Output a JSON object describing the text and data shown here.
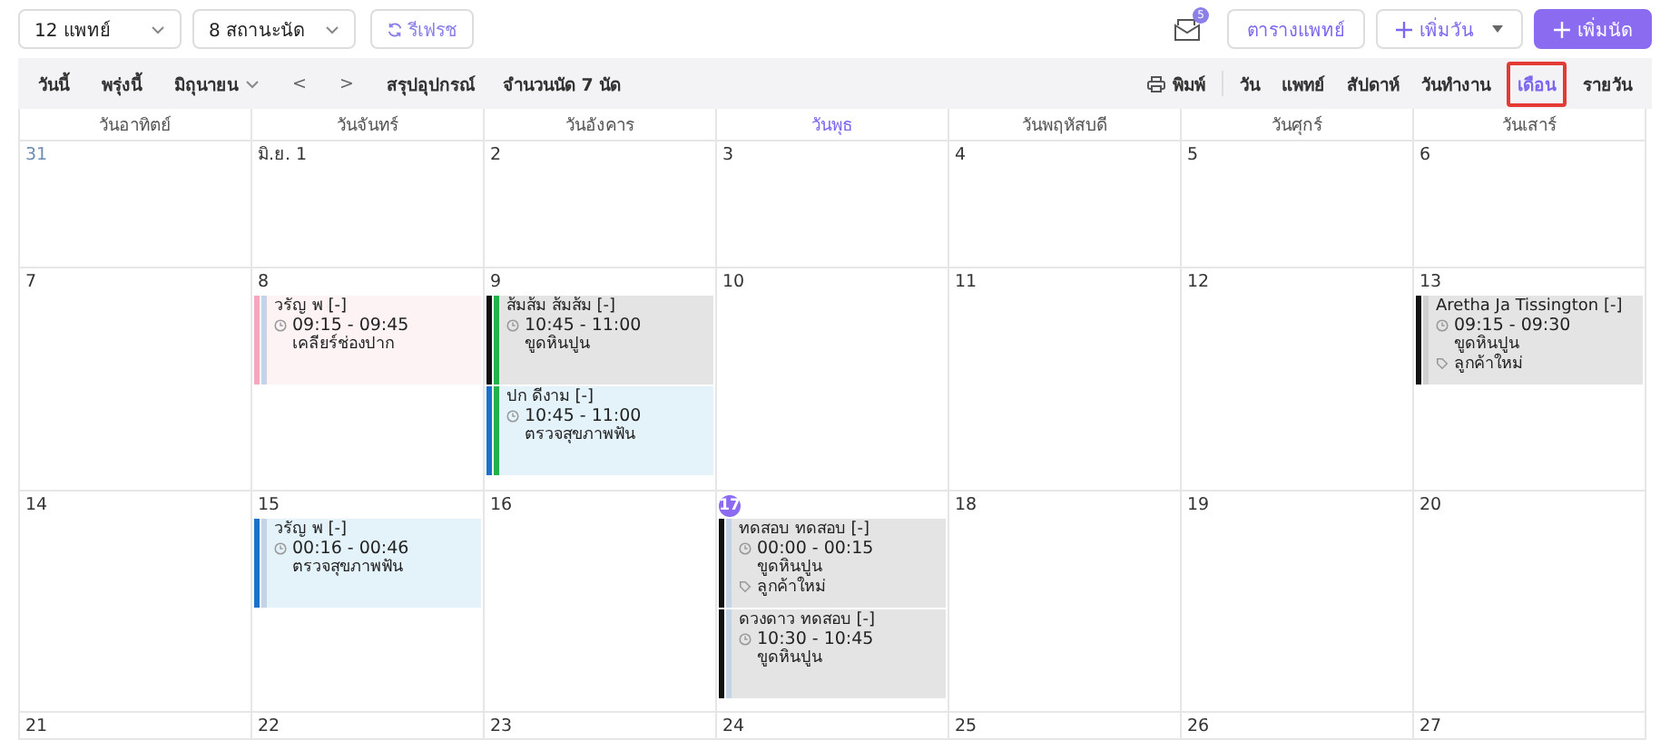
{
  "filters": [
    {
      "label": "12 แพทย์"
    },
    {
      "label": "8 สถานะนัด"
    }
  ],
  "refresh_button": "รีเฟรช",
  "inbox_badge": "5",
  "actions": [
    {
      "label": "ตารางแพทย์",
      "kind": "outline"
    },
    {
      "label": "เพิ่มวัน",
      "kind": "dropdown"
    },
    {
      "label": "เพิ่มนัด",
      "kind": "primary"
    }
  ],
  "nav": {
    "today": "วันนี้",
    "tomorrow": "พรุ่งนี้",
    "month": "มิถุนายน",
    "prev": "<",
    "next": ">",
    "summary": "สรุปอุปกรณ์",
    "count": "จำนวนนัด 7 นัด"
  },
  "print_button": "พิมพ์",
  "views": [
    {
      "label": "วัน",
      "selected": false
    },
    {
      "label": "แพทย์",
      "selected": false
    },
    {
      "label": "สัปดาห์",
      "selected": false
    },
    {
      "label": "วันทำงาน",
      "selected": false
    },
    {
      "label": "เดือน",
      "selected": true
    },
    {
      "label": "รายวัน",
      "selected": false
    }
  ],
  "weekdays": [
    {
      "label": "วันอาทิตย์",
      "today": false
    },
    {
      "label": "วันจันทร์",
      "today": false
    },
    {
      "label": "วันอังคาร",
      "today": false
    },
    {
      "label": "วันพุธ",
      "today": true
    },
    {
      "label": "วันพฤหัสบดี",
      "today": false
    },
    {
      "label": "วันศุกร์",
      "today": false
    },
    {
      "label": "วันเสาร์",
      "today": false
    }
  ],
  "weeks": [
    {
      "days": [
        {
          "label": "31",
          "other_month": true,
          "today": false
        },
        {
          "label": "มิ.ย. 1",
          "other_month": false,
          "today": false
        },
        {
          "label": "2",
          "other_month": false,
          "today": false
        },
        {
          "label": "3",
          "other_month": false,
          "today": false
        },
        {
          "label": "4",
          "other_month": false,
          "today": false
        },
        {
          "label": "5",
          "other_month": false,
          "today": false
        },
        {
          "label": "6",
          "other_month": false,
          "today": false
        }
      ]
    },
    {
      "days": [
        {
          "label": "7",
          "other_month": false,
          "today": false
        },
        {
          "label": "8",
          "other_month": false,
          "today": false,
          "events": [
            {
              "patient": "วรัญ พ [-]",
              "time": "09:15 - 09:45",
              "treatment": "เคลียร์ช่องปาก",
              "background": {
                "color": "#fdf3f5"
              },
              "color": "#f4a7bd",
              "status": {
                "color": "#c4d4e6"
              }
            }
          ]
        },
        {
          "label": "9",
          "other_month": false,
          "today": false,
          "events": [
            {
              "patient": "ส้มส้ม ส้มส้ม [-]",
              "time": "10:45 - 11:00",
              "treatment": "ขูดหินปูน",
              "background": {
                "color": "#e4e4e4"
              },
              "color": "#111111",
              "status": {
                "color": "#22b14c"
              }
            },
            {
              "patient": "ปก ดีงาม [-]",
              "time": "10:45 - 11:00",
              "treatment": "ตรวจสุขภาพฟัน",
              "background": {
                "color": "#e4f2fa"
              },
              "color": "#1a73c9",
              "status": {
                "color": "#22b14c"
              }
            }
          ]
        },
        {
          "label": "10",
          "other_month": false,
          "today": false
        },
        {
          "label": "11",
          "other_month": false,
          "today": false
        },
        {
          "label": "12",
          "other_month": false,
          "today": false
        },
        {
          "label": "13",
          "other_month": false,
          "today": false,
          "events": [
            {
              "patient": "Aretha Ja Tissington [-]",
              "time": "09:15 - 09:30",
              "treatment": "ขูดหินปูน",
              "tag": "ลูกค้าใหม่",
              "background": {
                "color": "#e4e4e4"
              },
              "color": "#111111",
              "status": {
                "color": "#d0d0d0"
              }
            }
          ]
        }
      ]
    },
    {
      "days": [
        {
          "label": "14",
          "other_month": false,
          "today": false
        },
        {
          "label": "15",
          "other_month": false,
          "today": false,
          "events": [
            {
              "patient": "วรัญ พ [-]",
              "time": "00:16 - 00:46",
              "treatment": "ตรวจสุขภาพฟัน",
              "background": {
                "color": "#e4f2fa"
              },
              "color": "#1a73c9",
              "status": {
                "color": "#c4d4e6"
              }
            }
          ]
        },
        {
          "label": "16",
          "other_month": false,
          "today": false
        },
        {
          "label": "17",
          "other_month": false,
          "today": true,
          "events": [
            {
              "patient": "ทดสอบ ทดสอบ [-]",
              "time": "00:00 - 00:15",
              "treatment": "ขูดหินปูน",
              "tag": "ลูกค้าใหม่",
              "background": {
                "color": "#e4e4e4"
              },
              "color": "#111111",
              "status": {
                "color": "#c4d4e6"
              }
            },
            {
              "patient": "ดวงดาว ทดสอบ [-]",
              "time": "10:30 - 10:45",
              "treatment": "ขูดหินปูน",
              "background": {
                "color": "#e4e4e4"
              },
              "color": "#111111",
              "status": {
                "color": "#c4d4e6"
              }
            }
          ]
        },
        {
          "label": "18",
          "other_month": false,
          "today": false
        },
        {
          "label": "19",
          "other_month": false,
          "today": false
        },
        {
          "label": "20",
          "other_month": false,
          "today": false
        }
      ]
    },
    {
      "days": [
        {
          "label": "21",
          "other_month": false,
          "today": false
        },
        {
          "label": "22",
          "other_month": false,
          "today": false
        },
        {
          "label": "23",
          "other_month": false,
          "today": false
        },
        {
          "label": "24",
          "other_month": false,
          "today": false
        },
        {
          "label": "25",
          "other_month": false,
          "today": false
        },
        {
          "label": "26",
          "other_month": false,
          "today": false
        },
        {
          "label": "27",
          "other_month": false,
          "today": false
        }
      ]
    }
  ]
}
